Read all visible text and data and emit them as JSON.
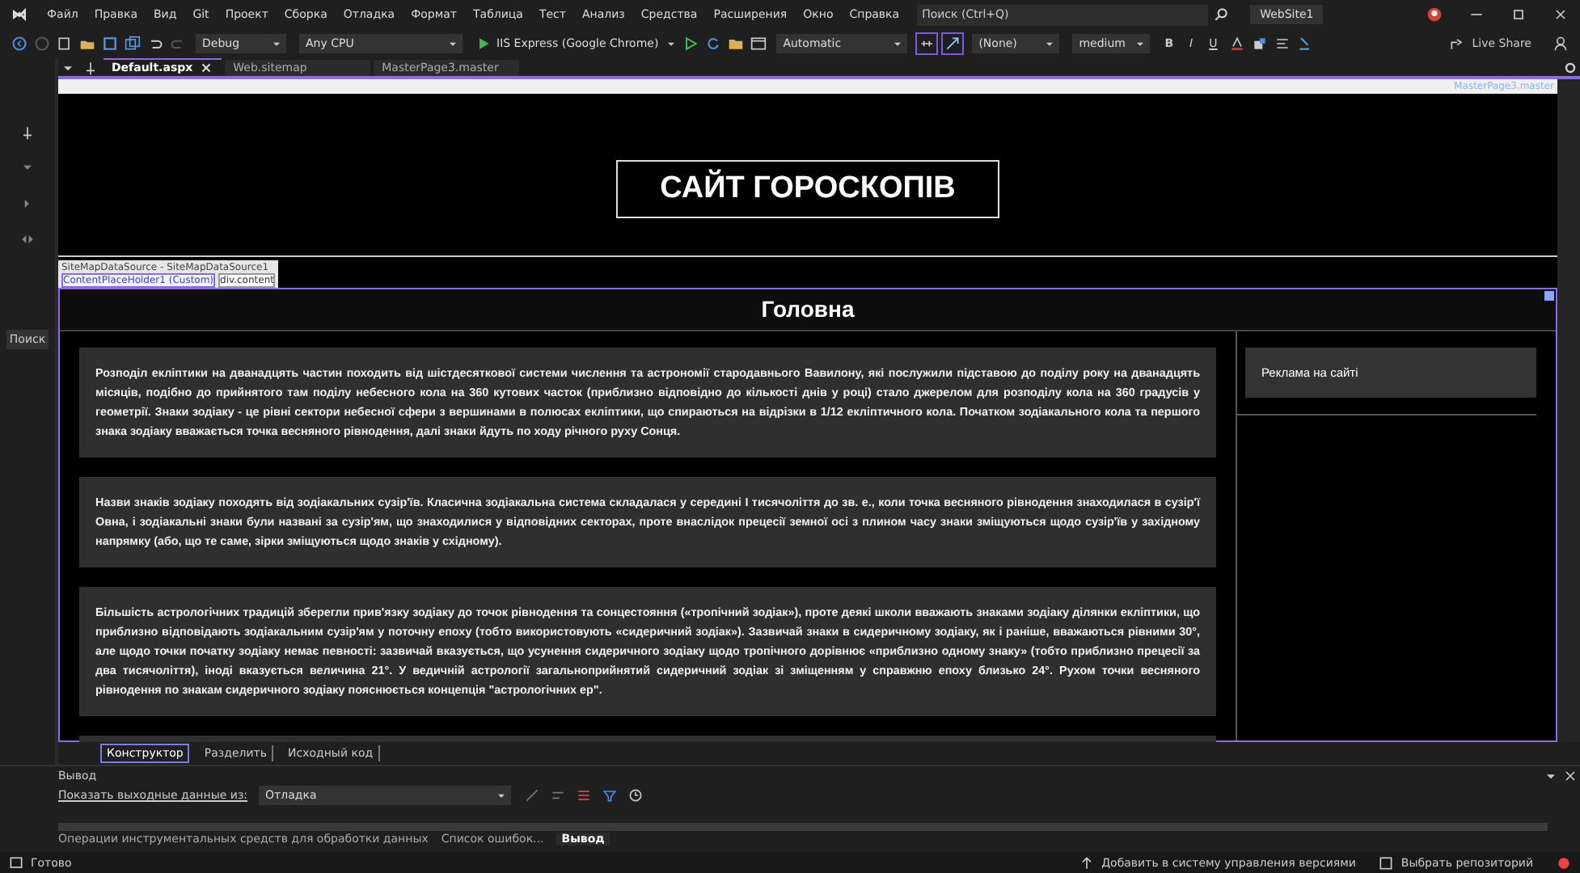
{
  "menu": {
    "items": [
      "Файл",
      "Правка",
      "Вид",
      "Git",
      "Проект",
      "Сборка",
      "Отладка",
      "Формат",
      "Таблица",
      "Тест",
      "Анализ",
      "Средства",
      "Расширения",
      "Окно",
      "Справка"
    ],
    "search": {
      "placeholder": "Поиск (Ctrl+Q)"
    },
    "solution": "WebSite1"
  },
  "toolbar": {
    "configuration": "Debug",
    "platform": "Any CPU",
    "run": "IIS Express (Google Chrome)",
    "target": "Automatic",
    "style": "(None)",
    "font_size": "medium",
    "bold": "B",
    "italic": "I",
    "underline": "U",
    "live_share": "Live Share"
  },
  "doc_tabs": [
    {
      "label": "Default.aspx",
      "selected": true
    },
    {
      "label": "Web.sitemap",
      "selected": false
    },
    {
      "label": "MasterPage3.master",
      "selected": false
    }
  ],
  "designer": {
    "master_label": "MasterPage3.master",
    "site_title": "САЙТ ГОРОСКОПІВ",
    "tag_labels": {
      "control": "SiteMapDataSource - SiteMapDataSource1",
      "placeholder": "ContentPlaceHolder1 (Custom)",
      "element": "div.content"
    },
    "heading": "Головна",
    "paragraphs": [
      "Розподіл екліптики на дванадцять частин походить від шістдесяткової системи числення та астрономії стародавнього Вавилону, які послужили підставою до поділу року на дванадцять місяців, подібно до прийнятого там поділу небесного кола на 360 кутових часток (приблизно відповідно до кількості днів у році) стало джерелом для розподілу кола на 360 градусів у геометрії. Знаки зодіаку - це рівні сектори небесної сфери з вершинами в полюсах екліптики, що спираються на відрізки в 1/12 екліптичного кола. Початком зодіакального кола та першого знака зодіаку вважається точка весняного рівнодення, далі знаки йдуть по ходу річного руху Сонця.",
      "Назви знаків зодіаку походять від зодіакальних сузір'їв. Класична зодіакальна система складалася у середині I тисячоліття до зв. е., коли точка весняного рівнодення знаходилася в сузір'ї Овна, і зодіакальні знаки були названі за сузір'ям, що знаходилися у відповідних секторах, проте внаслідок прецесії земної осі з плином часу знаки зміщуються щодо сузір'їв у західному напрямку (або, що те саме, зірки зміщуються щодо знаків у східному).",
      "Більшість астрологічних традицій зберегли прив'язку зодіаку до точок рівнодення та сонцестояння («тропічний зодіак»), проте деякі школи вважають знаками зодіаку ділянки екліптики, що приблизно відповідають зодіакальним сузір'ям у поточну епоху (тобто використовують «сидеричний зодіак»). Зазвичай знаки в сидеричному зодіаку, як і раніше, вважаються рівними 30°, але щодо точки початку зодіаку немає певності: зазвичай вказується, що усунення сидеричного зодіаку щодо тропічного дорівнює «приблизно одному знаку» (тобто приблизно прецесії за два тисячоліття), іноді вказується величина 21°. У ведичній астрології загальноприйнятий сидеричний зодіак зі зміщенням у справжню епоху близько 24°. Рухом точки весняного рівнодення по знакам сидеричного зодіаку пояснюється концепція \"астрологічних ер\"."
    ],
    "sidebar": "Реклама на сайті"
  },
  "left_strip": {
    "search_label": "Поиск"
  },
  "view_tabs": [
    {
      "label": "Конструктор",
      "selected": true
    },
    {
      "label": "Разделить",
      "selected": false
    },
    {
      "label": "Исходный код",
      "selected": false
    }
  ],
  "output": {
    "title": "Вывод",
    "show_from": "Показать выходные данные из:",
    "source": "Отладка"
  },
  "panel_tabs": [
    {
      "label": "Операции инструментальных средств для обработки данных",
      "selected": false
    },
    {
      "label": "Список ошибок...",
      "selected": false
    },
    {
      "label": "Вывод",
      "selected": true
    }
  ],
  "status_bar": {
    "text": "Готово",
    "source_control": "Добавить в систему управления версиями",
    "repository": "Выбрать репозиторий"
  }
}
